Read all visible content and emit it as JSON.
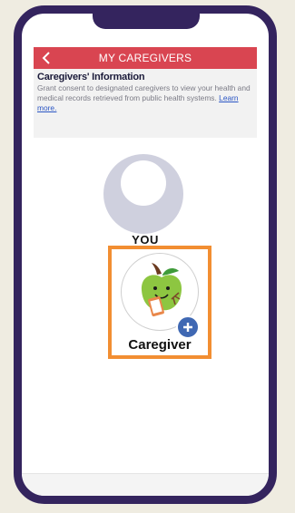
{
  "header": {
    "back_icon": "chevron-left-icon",
    "title": "MY CAREGIVERS"
  },
  "info": {
    "heading": "Caregivers' Information",
    "body": "Grant consent to designated caregivers to view your health and medical records retrieved from public health systems.",
    "link": "Learn more."
  },
  "you": {
    "label": "YOU",
    "avatar_icon": "default-avatar-icon"
  },
  "caregiver": {
    "label": "Caregiver",
    "icon": "apple-mascot-icon",
    "add_icon": "plus-icon"
  },
  "colors": {
    "phone_frame": "#34245e",
    "header": "#d94551",
    "highlight_border": "#f28e32",
    "add_button": "#3f68b3",
    "link": "#2a55c4",
    "background": "#efece1"
  }
}
